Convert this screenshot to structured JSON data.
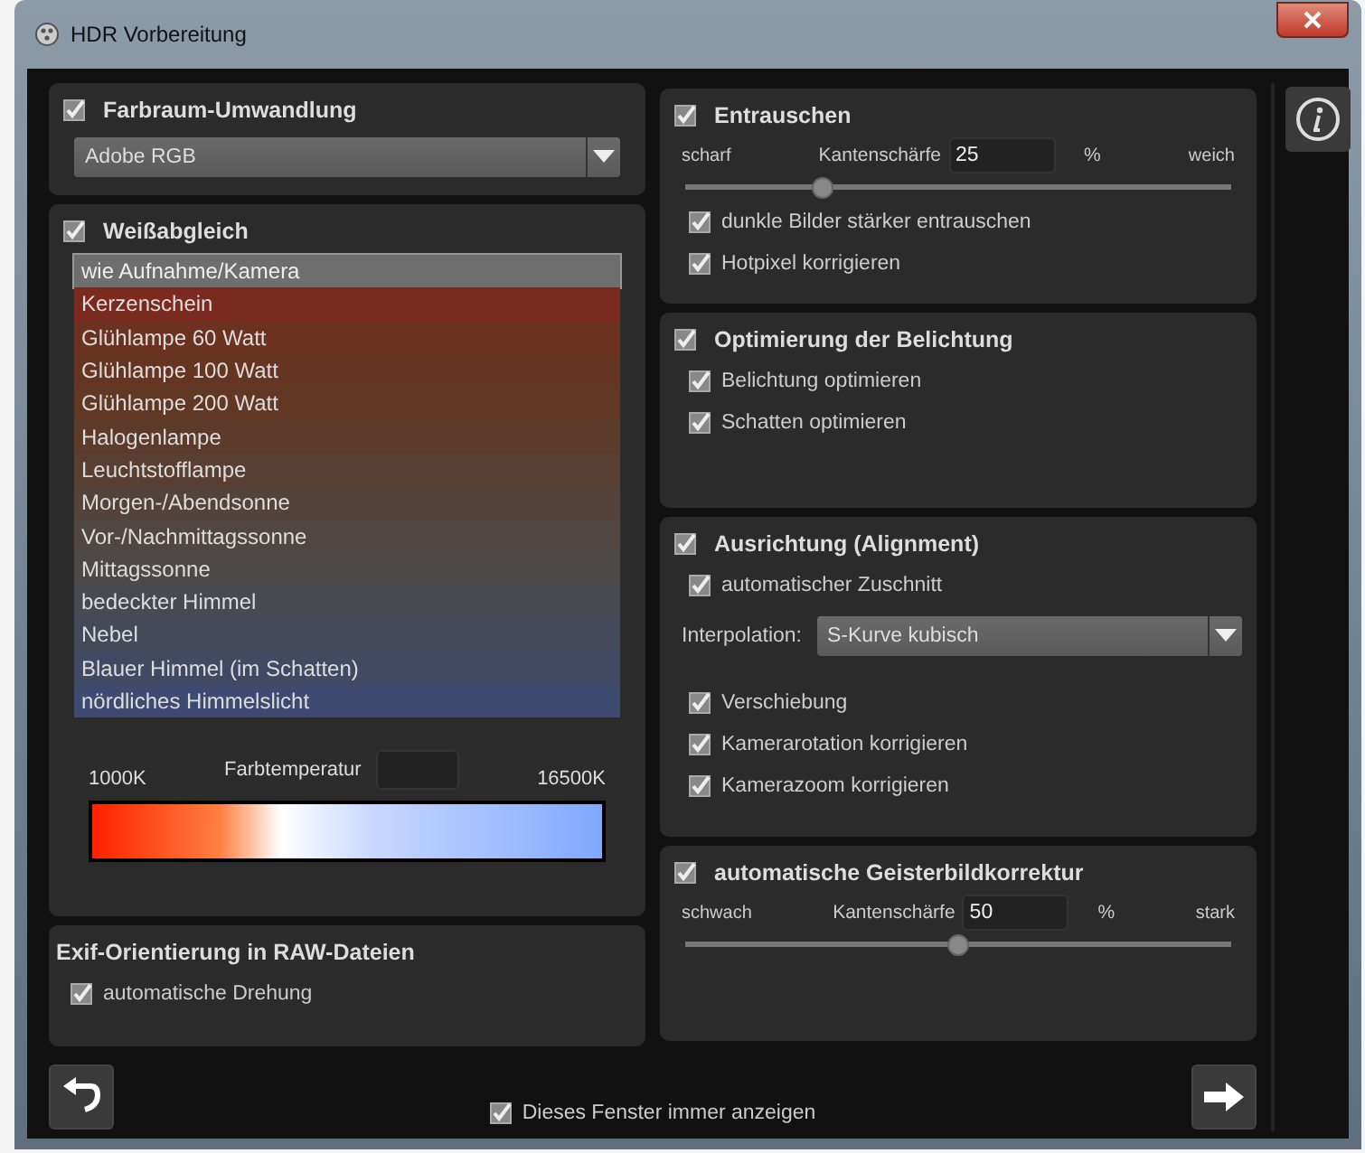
{
  "window": {
    "title": "HDR Vorbereitung"
  },
  "color_space": {
    "title": "Farbraum-Umwandlung",
    "checked": true,
    "value": "Adobe RGB"
  },
  "white_balance": {
    "title": "Weißabgleich",
    "checked": true,
    "presets": [
      {
        "label": "wie Aufnahme/Kamera",
        "selected": true,
        "color": "#6e6e6e"
      },
      {
        "label": "Kerzenschein",
        "selected": false,
        "color": "#7a2a1e"
      },
      {
        "label": "Glühlampe 60 Watt",
        "selected": false,
        "color": "#6c3220"
      },
      {
        "label": "Glühlampe 100 Watt",
        "selected": false,
        "color": "#663522"
      },
      {
        "label": "Glühlampe 200 Watt",
        "selected": false,
        "color": "#613824"
      },
      {
        "label": "Halogenlampe",
        "selected": false,
        "color": "#5c3b2a"
      },
      {
        "label": "Leuchtstofflampe",
        "selected": false,
        "color": "#583f32"
      },
      {
        "label": "Morgen-/Abendsonne",
        "selected": false,
        "color": "#54433a"
      },
      {
        "label": "Vor-/Nachmittagssonne",
        "selected": false,
        "color": "#504642"
      },
      {
        "label": "Mittagssonne",
        "selected": false,
        "color": "#4c4948"
      },
      {
        "label": "bedeckter Himmel",
        "selected": false,
        "color": "#484a52"
      },
      {
        "label": "Nebel",
        "selected": false,
        "color": "#454a5a"
      },
      {
        "label": "Blauer Himmel (im Schatten)",
        "selected": false,
        "color": "#424a63"
      },
      {
        "label": "nördliches Himmelslicht",
        "selected": false,
        "color": "#3e4a70"
      }
    ],
    "min_label": "1000K",
    "temp_label": "Farbtemperatur",
    "max_label": "16500K"
  },
  "exif": {
    "title": "Exif-Orientierung in RAW-Dateien",
    "options": [
      {
        "label": "automatische Drehung",
        "checked": true
      }
    ]
  },
  "denoise": {
    "title": "Entrauschen",
    "checked": true,
    "left_label": "scharf",
    "field_label": "Kantenschärfe",
    "value": "25",
    "unit": "%",
    "right_label": "weich",
    "level": 0.25,
    "options": [
      {
        "label": "dunkle Bilder stärker entrauschen",
        "checked": true
      },
      {
        "label": "Hotpixel korrigieren",
        "checked": true
      }
    ]
  },
  "exposure": {
    "title": "Optimierung der Belichtung",
    "checked": true,
    "options": [
      {
        "label": "Belichtung optimieren",
        "checked": true
      },
      {
        "label": "Schatten optimieren",
        "checked": true
      }
    ]
  },
  "alignment": {
    "title": "Ausrichtung (Alignment)",
    "checked": true,
    "crop": {
      "label": "automatischer Zuschnitt",
      "checked": true
    },
    "interpolation_label": "Interpolation:",
    "interpolation": "S-Kurve kubisch",
    "options": [
      {
        "label": "Verschiebung",
        "checked": true
      },
      {
        "label": "Kamerarotation korrigieren",
        "checked": true
      },
      {
        "label": "Kamerazoom korrigieren",
        "checked": true
      }
    ]
  },
  "ghosting": {
    "title": "automatische Geisterbildkorrektur",
    "checked": true,
    "left_label": "schwach",
    "field_label": "Kantenschärfe",
    "value": "50",
    "unit": "%",
    "right_label": "stark",
    "level": 0.5
  },
  "footer": {
    "always_show": {
      "label": "Dieses Fenster immer anzeigen",
      "checked": true
    }
  }
}
